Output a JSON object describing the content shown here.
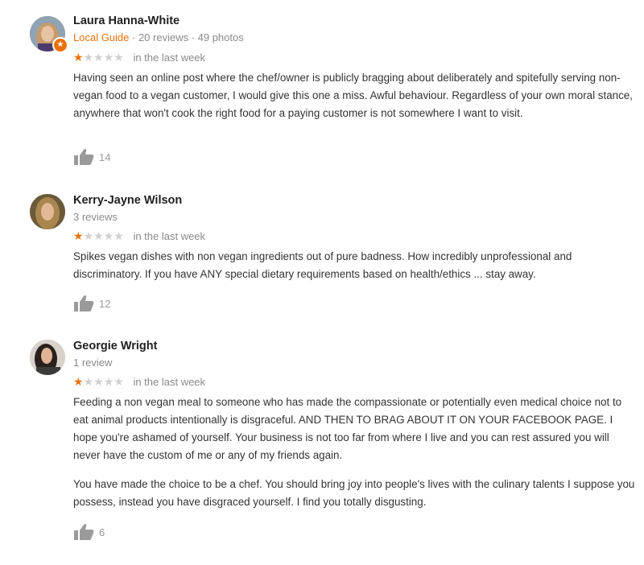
{
  "reviews": [
    {
      "name": "Laura Hanna-White",
      "guide_label": "Local Guide",
      "meta_rest": " · 20 reviews · 49 photos",
      "rating": 1,
      "when": "in the last week",
      "paragraphs": [
        "Having seen an online post where the chef/owner is publicly bragging about deliberately and spitefully serving non-vegan food to a vegan customer, I would give this one a miss. Awful behaviour. Regardless of your own moral stance, anywhere that won't cook the right food for a paying customer is not somewhere I want to visit."
      ],
      "likes": "14",
      "avatar_icon": "avatar-icon",
      "badge_icon": "star-badge-icon"
    },
    {
      "name": "Kerry-Jayne Wilson",
      "meta": "3 reviews",
      "rating": 1,
      "when": "in the last week",
      "paragraphs": [
        "Spikes vegan dishes with non vegan ingredients out of pure badness. How incredibly unprofessional and discriminatory. If you have ANY special dietary requirements based on health/ethics ... stay away."
      ],
      "likes": "12",
      "avatar_icon": "avatar-icon"
    },
    {
      "name": "Georgie Wright",
      "meta": "1 review",
      "rating": 1,
      "when": "in the last week",
      "paragraphs": [
        "Feeding a non vegan meal to someone who has made the compassionate or potentially even medical choice not to eat animal products intentionally is disgraceful. AND THEN TO BRAG ABOUT IT ON YOUR FACEBOOK PAGE.  I hope you're ashamed of yourself. Your business is not too far from where I live and you can rest assured you will never have the custom of me or any of my friends again.",
        "You have made the choice to be a chef. You should bring joy into people's lives with the culinary talents I suppose you possess, instead you have disgraced yourself. I find you totally disgusting."
      ],
      "likes": "6",
      "avatar_icon": "avatar-icon"
    }
  ],
  "colors": {
    "guide_orange": "#e8710a",
    "star_active": "#e8710a",
    "star_inactive": "#d0d0d0",
    "meta_gray": "#8a8a8a"
  },
  "icons": {
    "star": "star-icon",
    "thumbs_up": "thumbs-up-icon"
  }
}
